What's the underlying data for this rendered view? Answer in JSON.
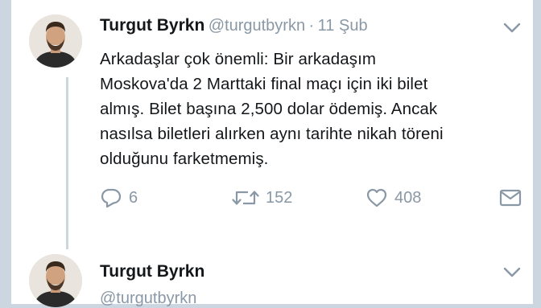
{
  "tweet1": {
    "display_name": "Turgut Byrkn",
    "handle": "@turgutbyrkn",
    "separator": "·",
    "date": "11 Şub",
    "text_lines": [
      "Arkadaşlar çok önemli: Bir arkadaşım",
      "Moskova'da 2 Marttaki final maçı için iki bilet",
      "almış. Bilet başına 2,500 dolar ödemiş. Ancak",
      "nasılsa biletleri alırken aynı tarihte nikah töreni",
      "olduğunu farketmemiş."
    ],
    "reply_count": "6",
    "retweet_count": "152",
    "like_count": "408"
  },
  "tweet2": {
    "display_name": "Turgut Byrkn",
    "handle": "@turgutbyrkn"
  },
  "icons": {
    "reply": "reply-icon",
    "retweet": "retweet-icon",
    "like": "heart-icon",
    "dm": "envelope-icon",
    "menu": "chevron-down-icon"
  },
  "colors": {
    "text": "#14171a",
    "muted": "#8a98a6",
    "background": "#ccd6e0",
    "card": "#ffffff"
  }
}
